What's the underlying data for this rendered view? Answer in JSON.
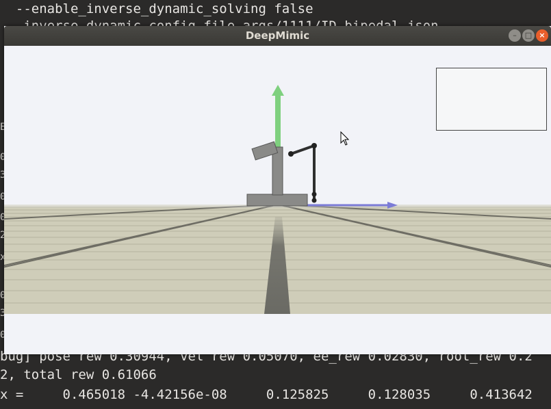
{
  "terminal": {
    "top_lines": [
      "  --enable_inverse_dynamic_solving false",
      "   inverse dynamic config file args/1111/ID_bipedal.json"
    ],
    "gutter": [
      "E",
      "0",
      "3",
      "0",
      "0",
      "2",
      "x",
      "0",
      "3",
      "0"
    ],
    "bottom_lines": [
      "bug] pose rew 0.30944, vel rew 0.05070, ee_rew 0.02830, root_rew 0.2",
      "2, total rew 0.61066",
      "x =     0.465018 -4.42156e-08     0.125825     0.128035     0.413642"
    ]
  },
  "window": {
    "title": "DeepMimic",
    "minimize_symbol": "–",
    "maximize_symbol": "□",
    "close_symbol": "×"
  },
  "scene": {
    "sky_color": "#f2f3f8",
    "ground_color": "#cfcdb9",
    "up_axis_color": "#7fd07f",
    "x_axis_color": "#7f7fd8"
  },
  "icons": {
    "cursor": "mouse-pointer-icon"
  }
}
